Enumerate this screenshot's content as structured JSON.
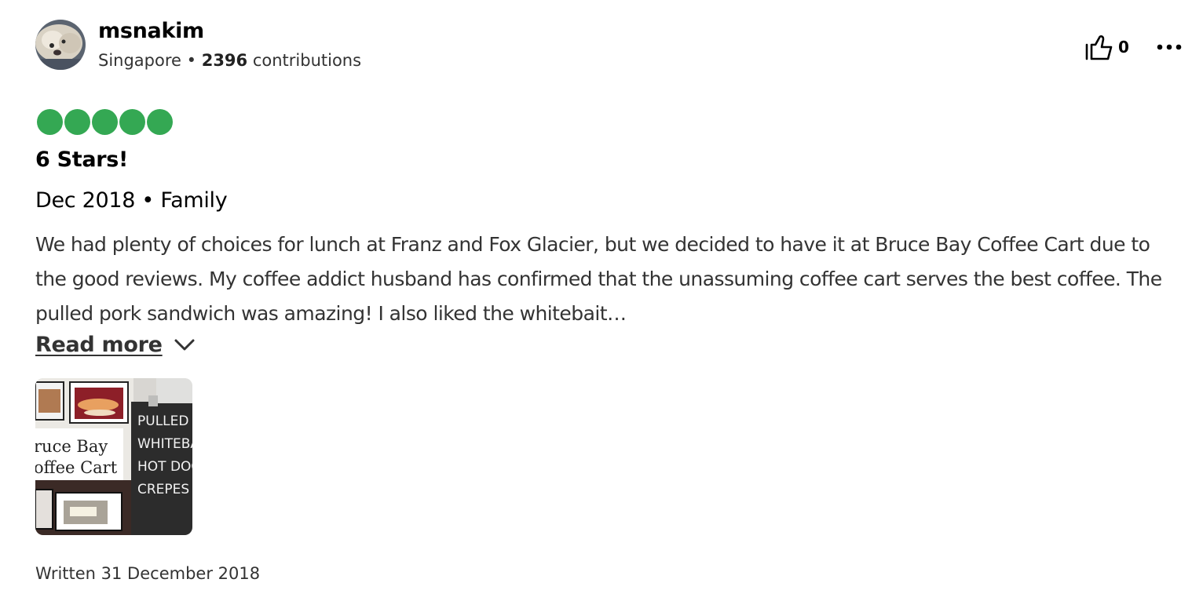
{
  "reviewer": {
    "name": "msnakim",
    "location": "Singapore",
    "separator": " • ",
    "contributions_count": "2396",
    "contributions_label": " contributions"
  },
  "actions": {
    "helpful_count": "0",
    "helpful_icon": "thumbs-up-icon",
    "more_icon": "more-options-icon"
  },
  "rating": {
    "value": 5,
    "max": 5,
    "color": "#34a853"
  },
  "review": {
    "title": "6 Stars!",
    "trip_info": "Dec 2018 • Family",
    "text": "We had plenty of choices for lunch at Franz and Fox Glacier, but we decided to have it at Bruce Bay Coffee Cart due to the good reviews. My coffee addict husband has confirmed that the unassuming coffee cart serves the best coffee. The pulled pork sandwich was amazing! I also liked the whitebait…",
    "read_more_label": "Read more"
  },
  "photo": {
    "sign_line_1": "ruce Bay",
    "sign_line_2": "offee Cart",
    "menu_items": [
      "PULLED P",
      "WHITEBA",
      "HOT DOG",
      "CREPES"
    ]
  },
  "footer": {
    "written_date": "Written 31 December 2018"
  }
}
